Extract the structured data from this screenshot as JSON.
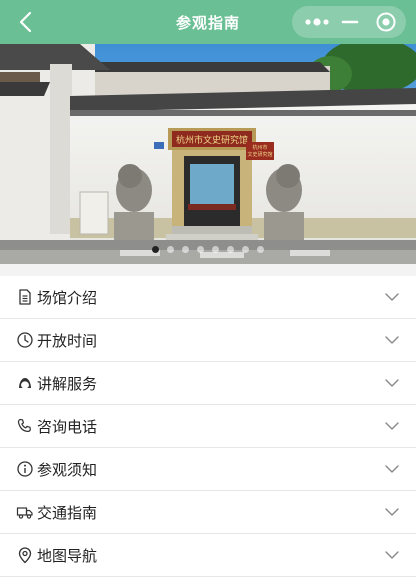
{
  "header": {
    "title": "参观指南",
    "back_icon": "chevron-left-icon",
    "capsule": {
      "more_icon": "more-dots-icon",
      "minimize_icon": "minus-icon",
      "close_icon": "target-circle-icon"
    },
    "background_color": "#6bbf95"
  },
  "hero": {
    "gate_plaque": "杭州市文史研究馆",
    "side_plaque_line1": "杭州市",
    "side_plaque_line2": "文史研究馆",
    "carousel_dots": 8,
    "active_dot": 0
  },
  "menu": [
    {
      "label": "场馆介绍",
      "icon": "document-icon"
    },
    {
      "label": "开放时间",
      "icon": "clock-icon"
    },
    {
      "label": "讲解服务",
      "icon": "guide-person-icon"
    },
    {
      "label": "咨询电话",
      "icon": "phone-icon"
    },
    {
      "label": "参观须知",
      "icon": "info-icon"
    },
    {
      "label": "交通指南",
      "icon": "truck-icon"
    },
    {
      "label": "地图导航",
      "icon": "location-pin-icon"
    }
  ]
}
